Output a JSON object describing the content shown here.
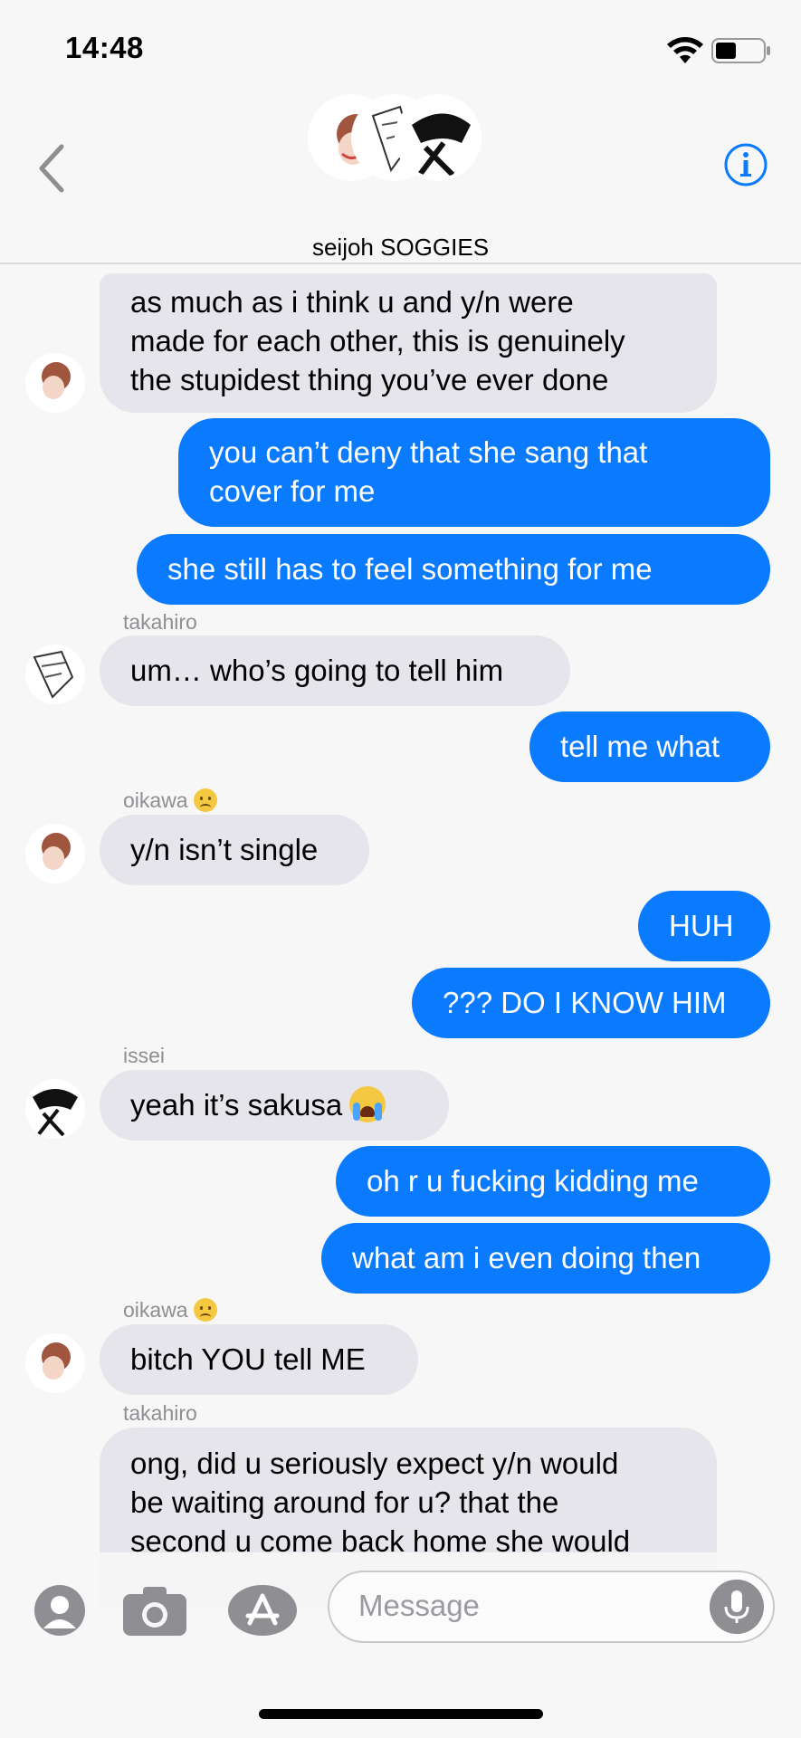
{
  "status_bar": {
    "time": "14:48"
  },
  "header": {
    "group_name": "seijoh SOGGIES"
  },
  "messages": [
    {
      "lines": [
        "as much as i think u and y/n were",
        "made for each other, this is genuinely",
        "the stupidest thing you’ve ever done"
      ]
    },
    {
      "lines": [
        "you can’t deny that she sang that",
        "cover for me"
      ]
    },
    {
      "text": "she still has to feel something for me"
    },
    {
      "sender": "takahiro",
      "text": "um… who’s going to tell him"
    },
    {
      "text": "tell me what"
    },
    {
      "sender": "oikawa",
      "sender_emoji": "frowning-face",
      "text": "y/n isn’t single"
    },
    {
      "text": "HUH"
    },
    {
      "text": "??? DO I KNOW HIM"
    },
    {
      "sender": "issei",
      "text": "yeah it’s sakusa",
      "emoji": "loudly-crying-face"
    },
    {
      "text": "oh r u fucking kidding me"
    },
    {
      "text": "what am i even doing then"
    },
    {
      "sender": "oikawa",
      "sender_emoji": "frowning-face",
      "text": "bitch YOU tell ME"
    },
    {
      "sender": "takahiro",
      "lines": [
        "ong, did u seriously expect y/n would",
        "be waiting around for u? that the",
        "second u come back home she would"
      ]
    }
  ],
  "composer": {
    "placeholder": "Message",
    "icons": [
      "memoji-icon",
      "camera-icon",
      "app-store-icon",
      "microphone-icon"
    ]
  },
  "colors": {
    "outgoing": "#0a7aff",
    "incoming": "#e6e5eb",
    "info": "#0a7aff"
  }
}
